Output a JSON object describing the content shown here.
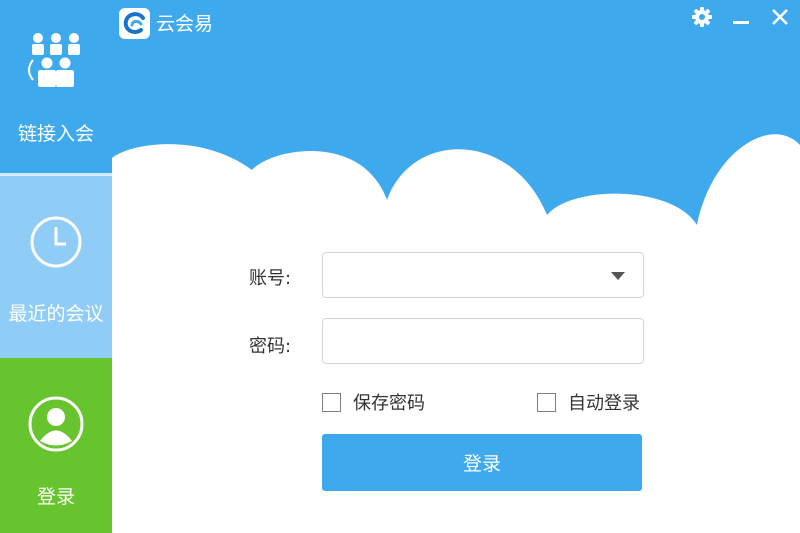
{
  "app": {
    "title": "云会易"
  },
  "window_controls": {
    "settings": "gear-icon",
    "minimize": "minimize-icon",
    "close": "close-icon"
  },
  "sidebar": {
    "items": [
      {
        "label": "链接入会",
        "icon": "group-icon",
        "state": "default"
      },
      {
        "label": "最近的会议",
        "icon": "clock-icon",
        "state": "default"
      },
      {
        "label": "登录",
        "icon": "user-icon",
        "state": "selected"
      }
    ]
  },
  "login_form": {
    "account_label": "账号:",
    "account_value": "",
    "password_label": "密码:",
    "password_value": "",
    "remember_password": {
      "label": "保存密码",
      "checked": false
    },
    "auto_login": {
      "label": "自动登录",
      "checked": false
    },
    "submit_label": "登录"
  },
  "colors": {
    "primary": "#3fa9ee",
    "sidebar_recent": "#8fcdf7",
    "sidebar_login": "#67c42f"
  }
}
